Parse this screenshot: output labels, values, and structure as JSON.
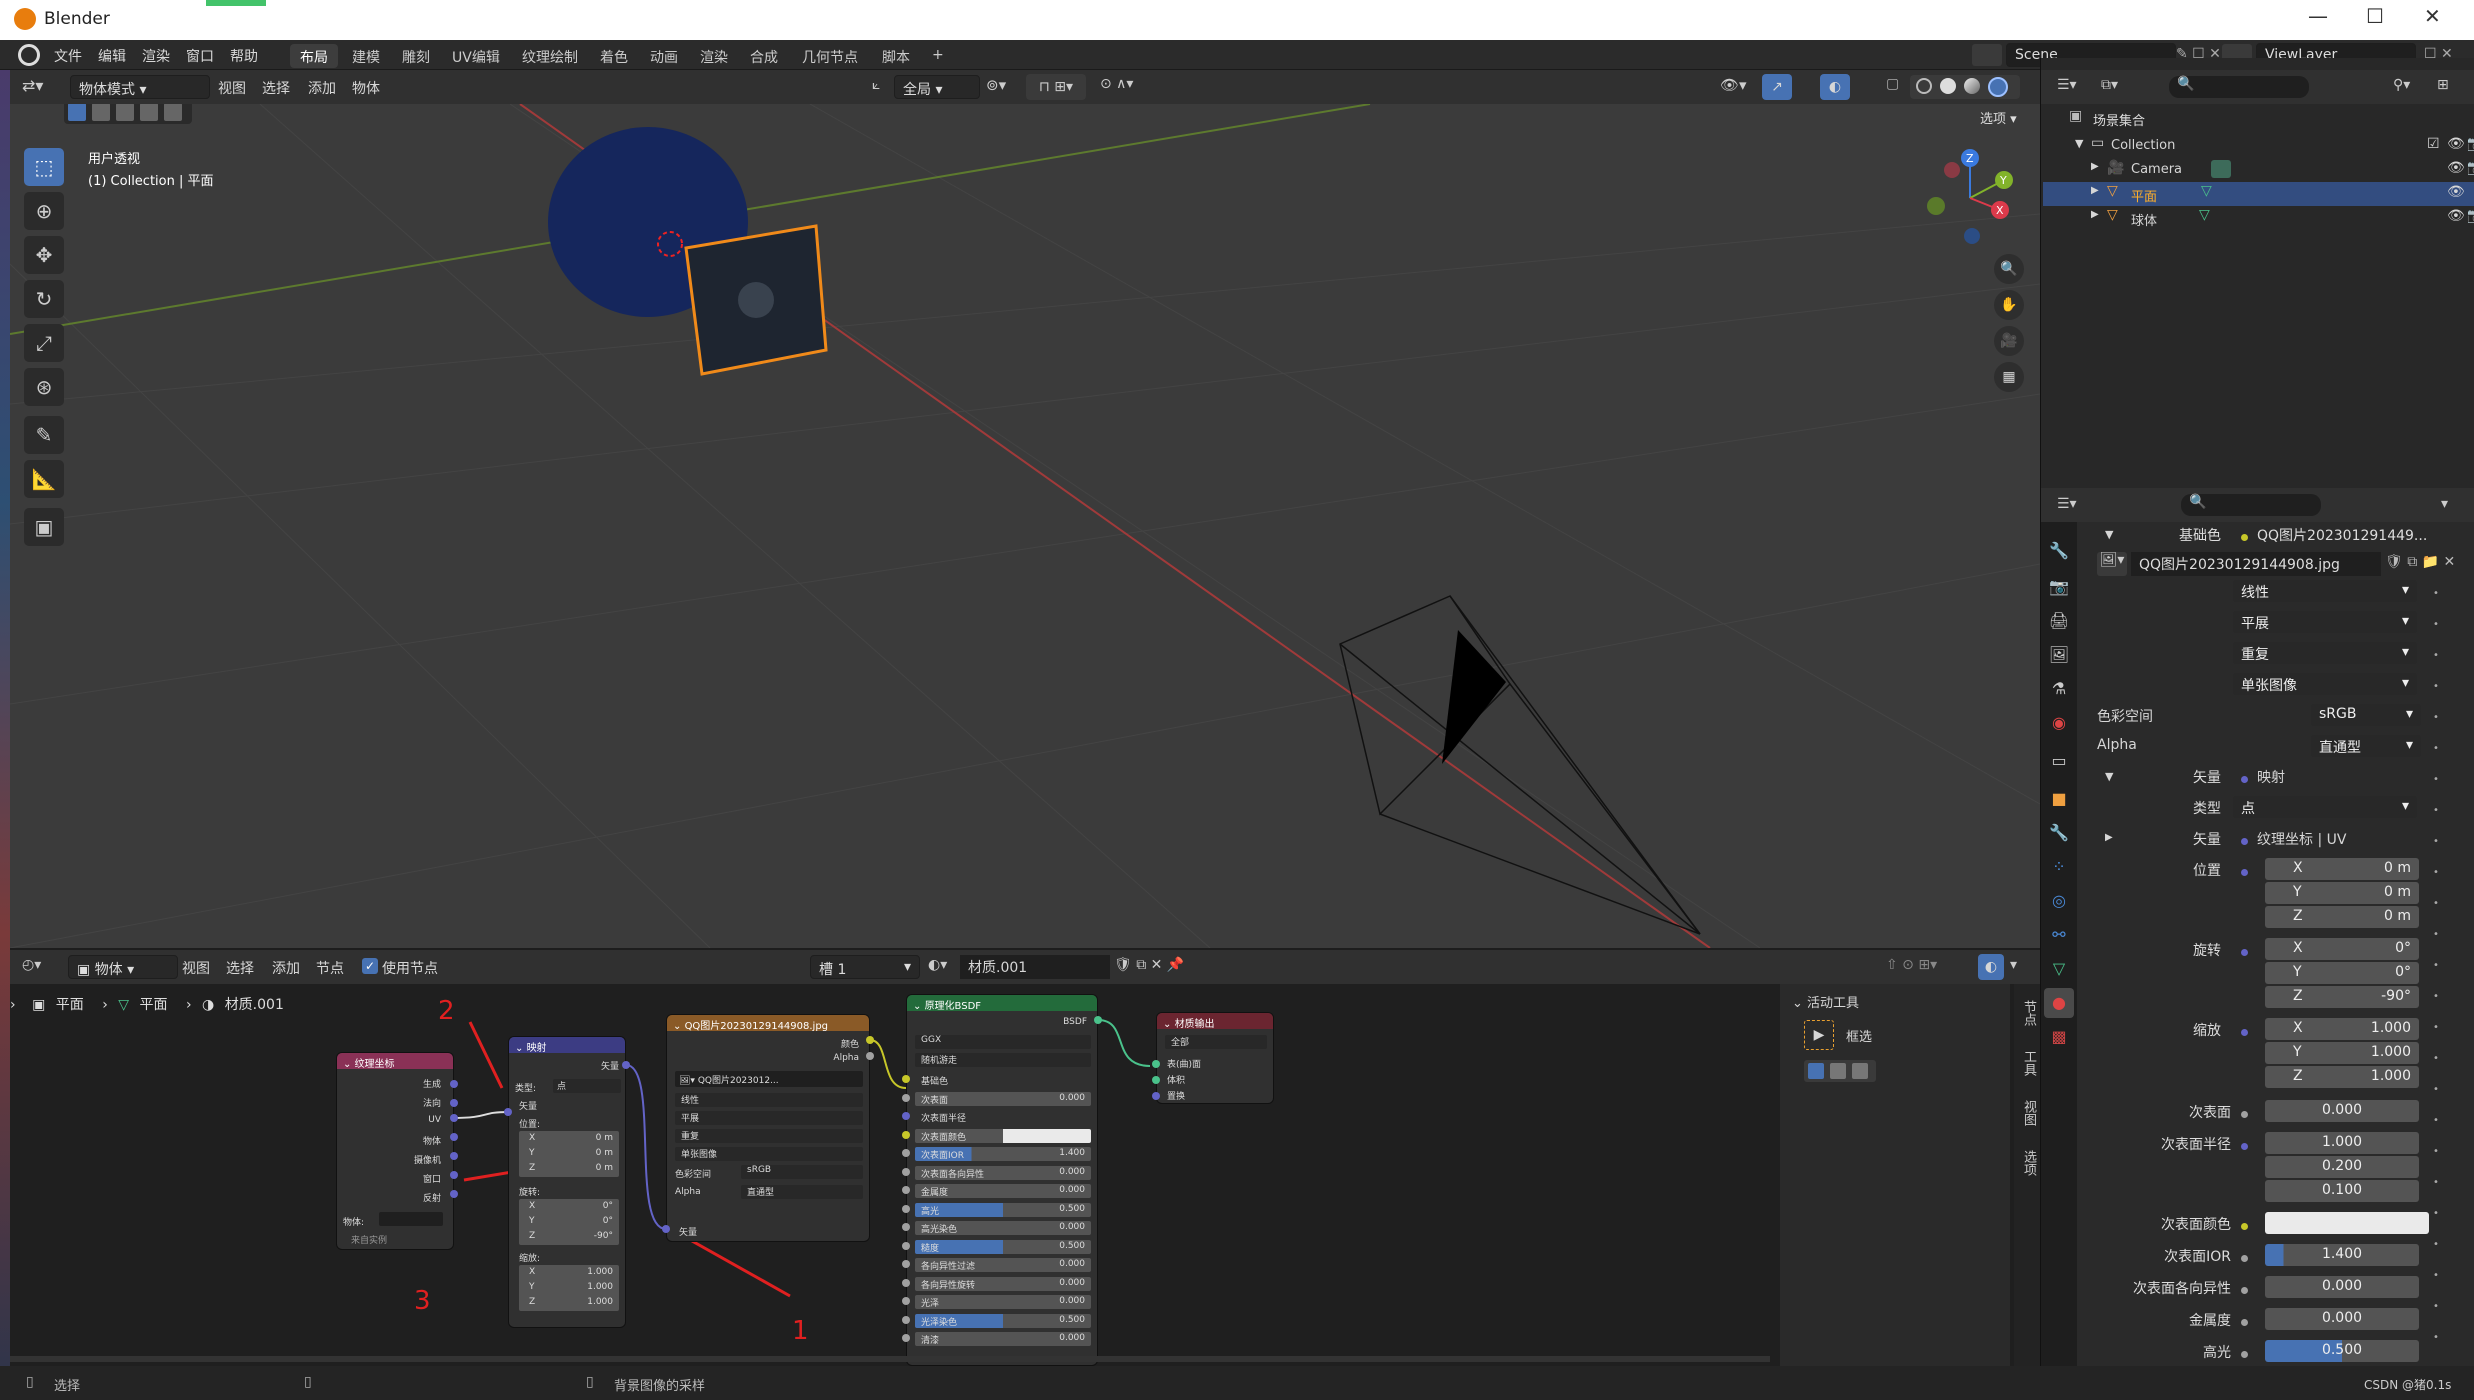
{
  "window": {
    "title": "Blender",
    "controls": [
      "—",
      "☐",
      "✕"
    ]
  },
  "menu": [
    "文件",
    "编辑",
    "渲染",
    "窗口",
    "帮助"
  ],
  "workspaces": [
    "布局",
    "建模",
    "雕刻",
    "UV编辑",
    "纹理绘制",
    "着色",
    "动画",
    "渲染",
    "合成",
    "几何节点",
    "脚本",
    "+"
  ],
  "active_workspace": "布局",
  "scene": {
    "label": "Scene",
    "view_layer": "ViewLayer"
  },
  "viewport": {
    "mode": "物体模式",
    "menus": [
      "视图",
      "选择",
      "添加",
      "物体"
    ],
    "transform": "全局",
    "options": "选项",
    "info_line1": "用户透视",
    "info_line2": "(1) Collection | 平面",
    "gizmo": {
      "x": "X",
      "y": "Y",
      "z": "Z"
    }
  },
  "outliner": {
    "root": "场景集合",
    "items": [
      {
        "name": "Collection",
        "icon": "collection-icon"
      },
      {
        "name": "Camera",
        "icon": "camera-icon"
      },
      {
        "name": "平面",
        "icon": "mesh-icon",
        "selected": true
      },
      {
        "name": "球体",
        "icon": "mesh-icon"
      }
    ]
  },
  "node_editor": {
    "type": "物体",
    "menus": [
      "视图",
      "选择",
      "添加",
      "节点"
    ],
    "use_nodes": "使用节点",
    "slot": "槽 1",
    "material": "材质.001",
    "breadcrumb": [
      "平面",
      "平面",
      "材质.001"
    ],
    "sidebar": {
      "title": "活动工具",
      "tool": "框选",
      "tabs": [
        "节点",
        "工具",
        "视图",
        "选项"
      ]
    },
    "annotations": [
      "2",
      "3",
      "1"
    ],
    "nodes": {
      "texcoord": {
        "title": "纹理坐标",
        "outputs": [
          "生成",
          "法向",
          "UV",
          "物体",
          "摄像机",
          "窗口",
          "反射"
        ],
        "object_label": "物体:",
        "instancer": "来自实例"
      },
      "mapping": {
        "title": "映射",
        "out": "矢量",
        "type_label": "类型:",
        "type_val": "点",
        "vector": "矢量",
        "location": "位置:",
        "loc": [
          "X",
          "0 m",
          "Y",
          "0 m",
          "Z",
          "0 m"
        ],
        "rotation": "旋转:",
        "rot": [
          "X",
          "0°",
          "Y",
          "0°",
          "Z",
          "-90°"
        ],
        "scale": "缩放:",
        "sca": [
          "X",
          "1.000",
          "Y",
          "1.000",
          "Z",
          "1.000"
        ]
      },
      "image": {
        "title": "QQ图片20230129144908.jpg",
        "out_color": "颜色",
        "out_alpha": "Alpha",
        "img": "QQ图片2023012...",
        "interp": "线性",
        "proj": "平展",
        "ext": "重复",
        "src": "单张图像",
        "cs_label": "色彩空间",
        "cs": "sRGB",
        "alpha_label": "Alpha",
        "alpha": "直通型",
        "vec": "矢量"
      },
      "bsdf": {
        "title": "原理化BSDF",
        "out": "BSDF",
        "dist": "GGX",
        "sss": "随机游走",
        "rows": [
          {
            "l": "基础色",
            "v": "",
            "c": "#c7c729"
          },
          {
            "l": "次表面",
            "v": "0.000",
            "c": "#a1a1a1"
          },
          {
            "l": "次表面半径",
            "v": "",
            "c": "#6363c7"
          },
          {
            "l": "次表面颜色",
            "v": "",
            "c": "#c7c729"
          },
          {
            "l": "次表面IOR",
            "v": "1.400",
            "c": "#a1a1a1"
          },
          {
            "l": "次表面各向异性",
            "v": "0.000",
            "c": "#a1a1a1"
          },
          {
            "l": "金属度",
            "v": "0.000",
            "c": "#a1a1a1"
          },
          {
            "l": "高光",
            "v": "0.500",
            "c": "#a1a1a1"
          },
          {
            "l": "高光染色",
            "v": "0.000",
            "c": "#a1a1a1"
          },
          {
            "l": "糙度",
            "v": "0.500",
            "c": "#a1a1a1"
          },
          {
            "l": "各向异性过滤",
            "v": "0.000",
            "c": "#a1a1a1"
          },
          {
            "l": "各向异性旋转",
            "v": "0.000",
            "c": "#a1a1a1"
          },
          {
            "l": "光泽",
            "v": "0.000",
            "c": "#a1a1a1"
          },
          {
            "l": "光泽染色",
            "v": "0.500",
            "c": "#a1a1a1"
          },
          {
            "l": "清漆",
            "v": "0.000",
            "c": "#a1a1a1"
          }
        ]
      },
      "output": {
        "title": "材质输出",
        "target": "全部",
        "inputs": [
          "表(曲)面",
          "体积",
          "置换"
        ]
      }
    }
  },
  "properties": {
    "base_color_label": "基础色",
    "base_color_val": "QQ图片202301291449...",
    "image_name": "QQ图片20230129144908.jpg",
    "interp": "线性",
    "proj": "平展",
    "ext": "重复",
    "src": "单张图像",
    "colorspace_label": "色彩空间",
    "colorspace": "sRGB",
    "alpha_label": "Alpha",
    "alpha": "直通型",
    "vector_label": "矢量",
    "vector_val": "映射",
    "type_label": "类型",
    "type_val": "点",
    "vector2_label": "矢量",
    "vector2_val": "纹理坐标 | UV",
    "location_label": "位置",
    "loc": [
      {
        "a": "X",
        "v": "0 m"
      },
      {
        "a": "Y",
        "v": "0 m"
      },
      {
        "a": "Z",
        "v": "0 m"
      }
    ],
    "rotation_label": "旋转",
    "rot": [
      {
        "a": "X",
        "v": "0°"
      },
      {
        "a": "Y",
        "v": "0°"
      },
      {
        "a": "Z",
        "v": "-90°"
      }
    ],
    "scale_label": "缩放",
    "sca": [
      {
        "a": "X",
        "v": "1.000"
      },
      {
        "a": "Y",
        "v": "1.000"
      },
      {
        "a": "Z",
        "v": "1.000"
      }
    ],
    "subsurface_label": "次表面",
    "subsurface": "0.000",
    "ss_radius_label": "次表面半径",
    "ss_radius": [
      "1.000",
      "0.200",
      "0.100"
    ],
    "ss_color_label": "次表面颜色",
    "ss_ior_label": "次表面IOR",
    "ss_ior": "1.400",
    "ss_aniso_label": "次表面各向异性",
    "ss_aniso": "0.000",
    "metallic_label": "金属度",
    "metallic": "0.000",
    "specular_label": "高光",
    "specular": "0.500"
  },
  "status": {
    "left": "选择",
    "mid": "背景图像的采样",
    "watermark": "CSDN @猪0.1s"
  }
}
